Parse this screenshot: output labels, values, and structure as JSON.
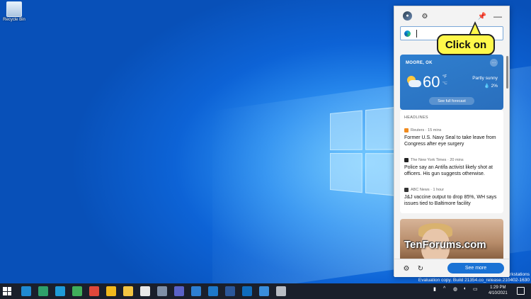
{
  "desktop": {
    "recycle_bin_label": "Recycle Bin",
    "watermark_line1": "Windows 10 Pro for Workstations",
    "watermark_line2": "Evaluation copy. Build 21354.co_release.210402-1630"
  },
  "panel": {
    "search_placeholder": "",
    "pin_tooltip": "",
    "callout_text": "Click on"
  },
  "weather": {
    "location": "MOORE, OK",
    "temperature": "60",
    "unit_f": "°F",
    "unit_c": "°C",
    "condition": "Partly sunny",
    "precip": "💧 2%",
    "forecast_button": "See full forecast",
    "more_label": "···"
  },
  "headlines": {
    "title": "HEADLINES",
    "items": [
      {
        "source": "Reuters · 15 mins",
        "headline": "Former U.S. Navy Seal to take leave from Congress after eye surgery",
        "color": "#f08b1f"
      },
      {
        "source": "The New York Times · 20 mins",
        "headline": "Police say an Antifa activist likely shot at officers. His gun suggests otherwise.",
        "color": "#222222"
      },
      {
        "source": "ABC News · 1 hour",
        "headline": "J&J vaccine output to drop 85%, WH says issues tied to Baltimore facility",
        "color": "#333333"
      }
    ]
  },
  "imagecard": {
    "watermark": "TenForums.com"
  },
  "bottom": {
    "see_more": "See more"
  },
  "taskbar": {
    "time": "1:29 PM",
    "date": "4/10/2021",
    "apps": [
      {
        "name": "edge-icon",
        "color": "#1f8ad2"
      },
      {
        "name": "edge-beta-icon",
        "color": "#2ea06a"
      },
      {
        "name": "edge-dev-icon",
        "color": "#1e9bd8"
      },
      {
        "name": "edge-canary-icon",
        "color": "#3fae5a"
      },
      {
        "name": "chrome-icon",
        "color": "#e0483b"
      },
      {
        "name": "chrome-canary-icon",
        "color": "#f2b91c"
      },
      {
        "name": "file-explorer-icon",
        "color": "#f4c542"
      },
      {
        "name": "store-icon",
        "color": "#e8e8e8"
      },
      {
        "name": "settings-app-icon",
        "color": "#7f8fa6"
      },
      {
        "name": "teams-icon",
        "color": "#5a62c7"
      },
      {
        "name": "remote-desktop-icon",
        "color": "#2d7fd2"
      },
      {
        "name": "phone-icon",
        "color": "#1e78c9"
      },
      {
        "name": "word-icon",
        "color": "#2b579a"
      },
      {
        "name": "outlook-icon",
        "color": "#0f6cbd"
      },
      {
        "name": "mail-icon",
        "color": "#3a8edc"
      },
      {
        "name": "settings-icon",
        "color": "#b8bcc4"
      }
    ]
  }
}
